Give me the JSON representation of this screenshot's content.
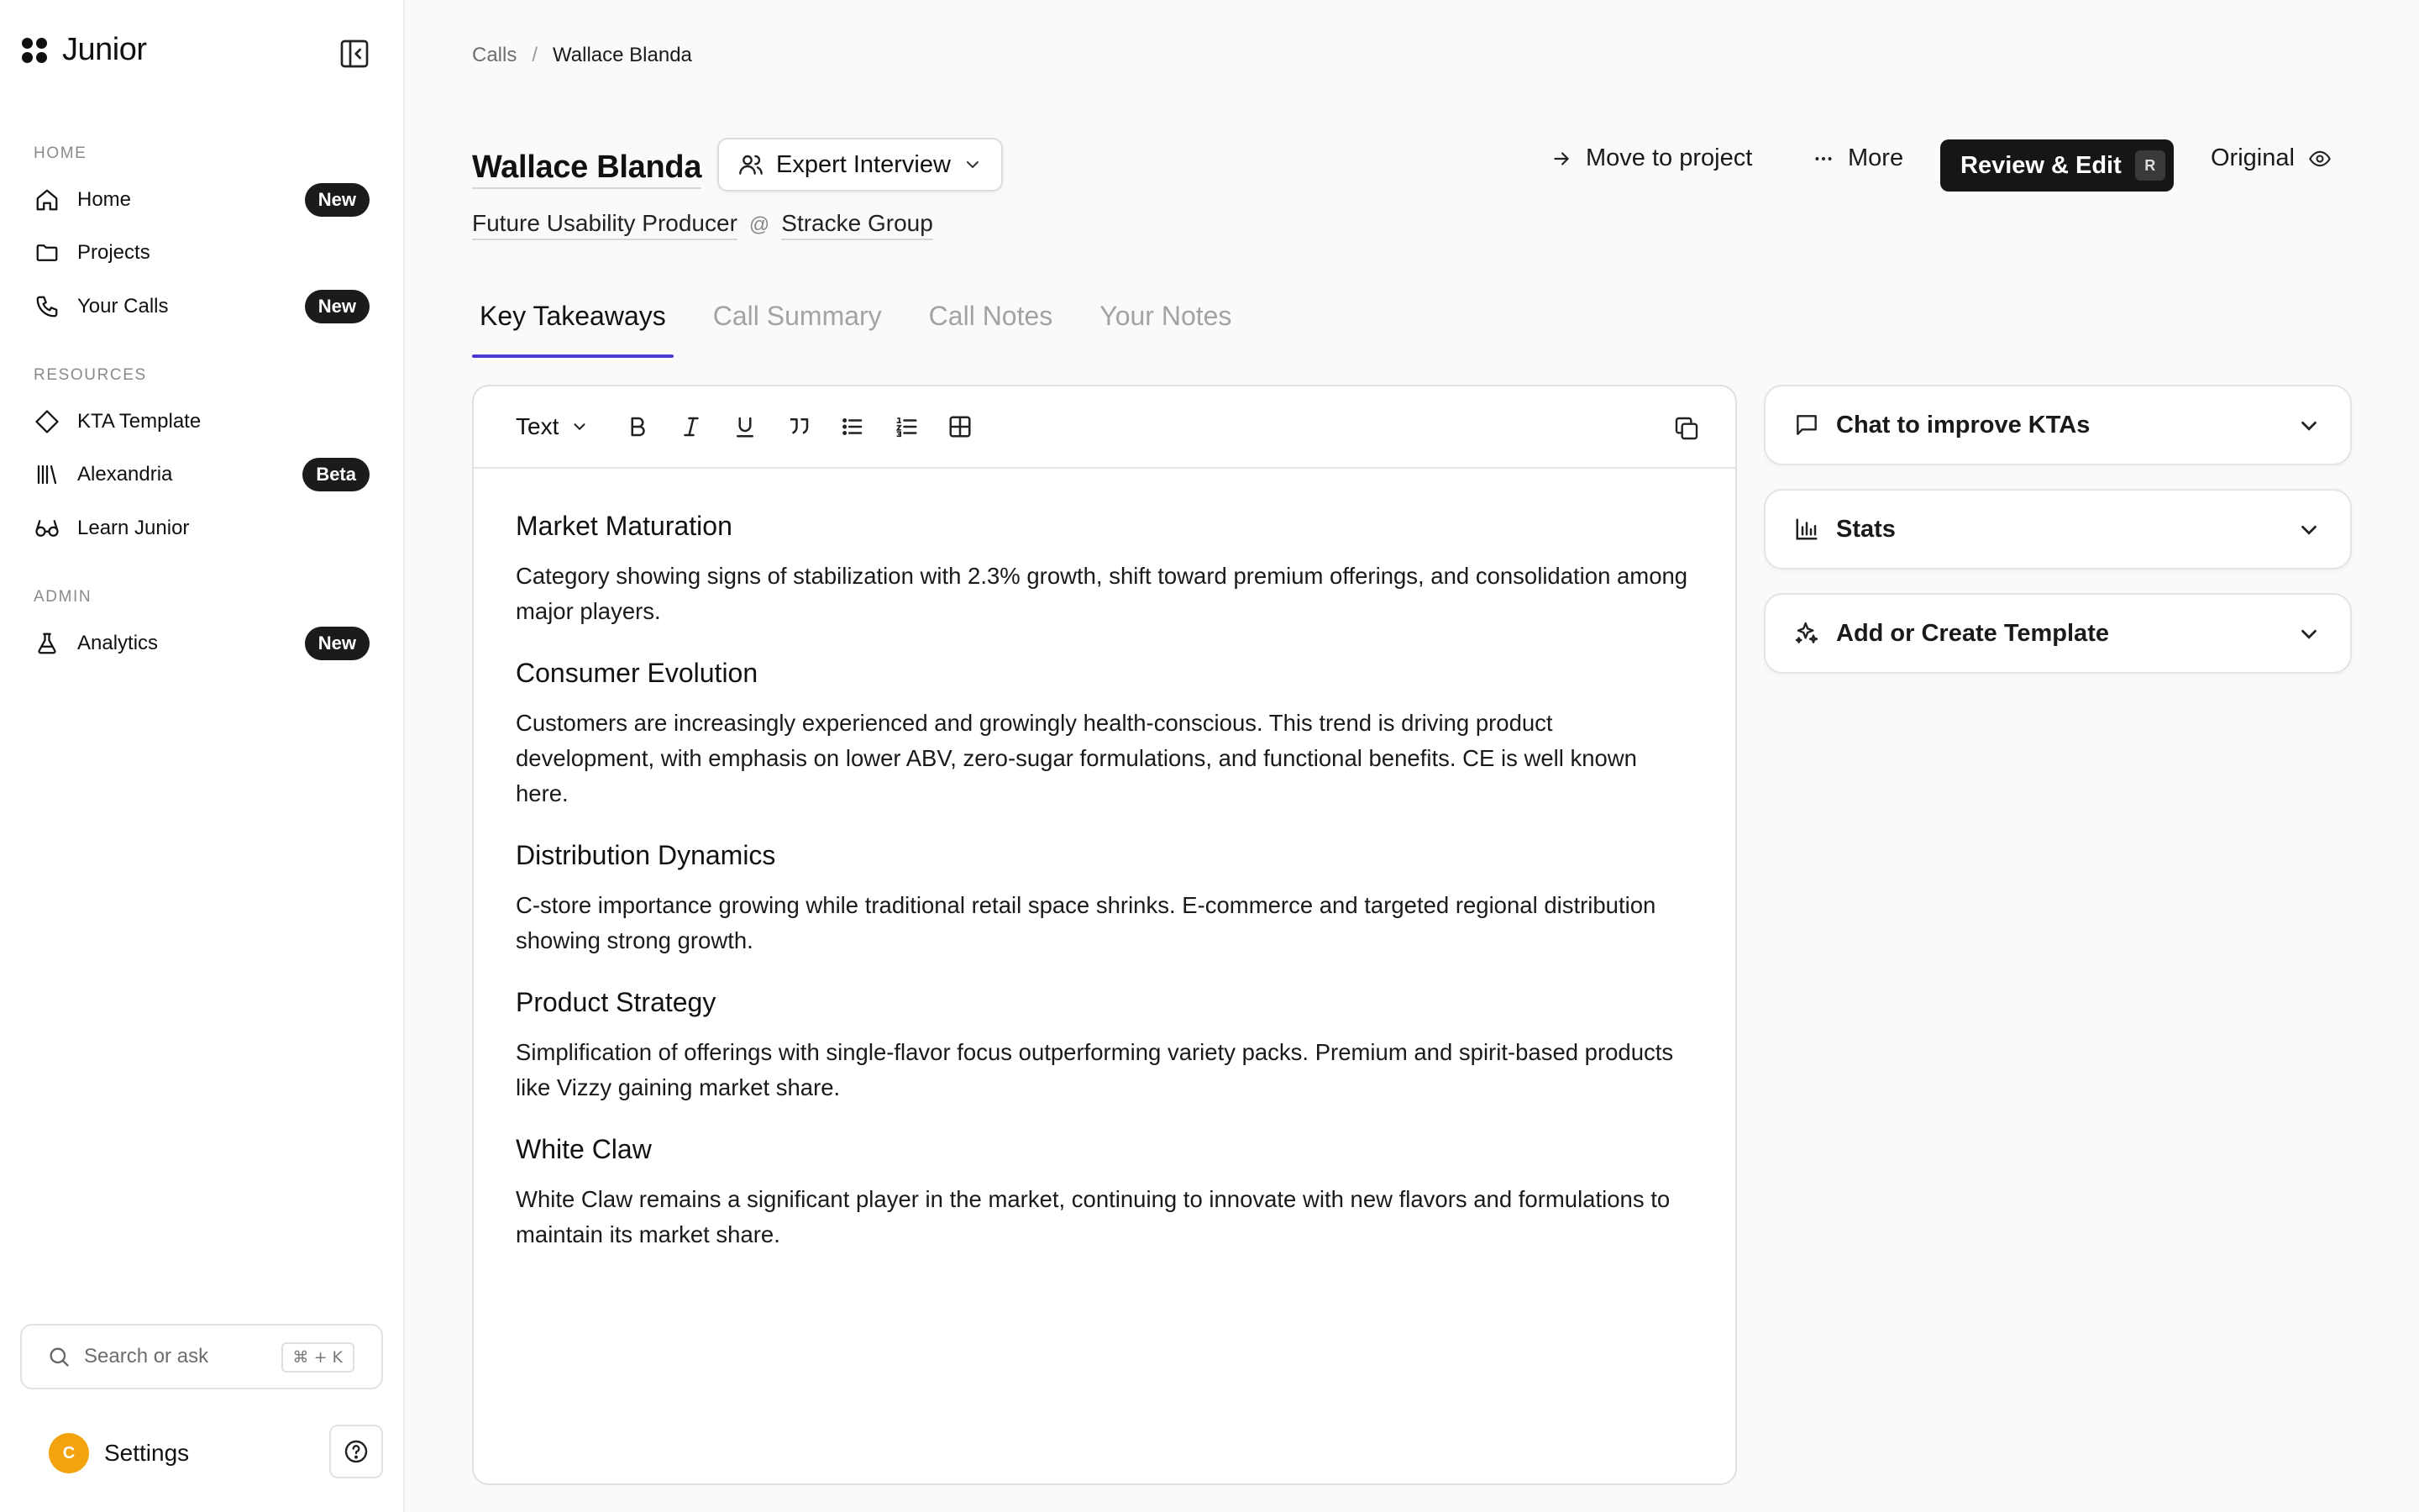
{
  "sidebar": {
    "brand": "Junior",
    "sections": {
      "home": "HOME",
      "resources": "RESOURCES",
      "admin": "ADMIN"
    },
    "items": [
      {
        "label": "Home",
        "icon": "home-icon",
        "badge": "New"
      },
      {
        "label": "Projects",
        "icon": "folder-icon",
        "badge": ""
      },
      {
        "label": "Your Calls",
        "icon": "phone-icon",
        "badge": "New"
      },
      {
        "label": "KTA Template",
        "icon": "diamond-icon",
        "badge": ""
      },
      {
        "label": "Alexandria",
        "icon": "library-icon",
        "badge": "Beta"
      },
      {
        "label": "Learn Junior",
        "icon": "glasses-icon",
        "badge": ""
      },
      {
        "label": "Analytics",
        "icon": "flask-icon",
        "badge": "New"
      }
    ],
    "search": {
      "placeholder": "Search or ask",
      "shortcut": "⌘ + K"
    },
    "settings": {
      "avatar_letter": "C",
      "label": "Settings"
    }
  },
  "breadcrumb": {
    "parent": "Calls",
    "separator": "/",
    "current": "Wallace Blanda"
  },
  "header": {
    "name": "Wallace Blanda",
    "call_type": "Expert Interview",
    "job_title": "Future Usability Producer",
    "at": "@",
    "company": "Stracke Group",
    "actions": {
      "move": "Move to project",
      "more": "More",
      "review": "Review & Edit",
      "review_shortcut": "R",
      "original": "Original"
    }
  },
  "tabs": [
    {
      "label": "Key Takeaways",
      "active": true
    },
    {
      "label": "Call Summary",
      "active": false
    },
    {
      "label": "Call Notes",
      "active": false
    },
    {
      "label": "Your Notes",
      "active": false
    }
  ],
  "editor": {
    "text_style": "Text",
    "sections": [
      {
        "heading": "Market Maturation",
        "body": "Category showing signs of stabilization with 2.3% growth, shift toward premium offerings, and consolidation among major players."
      },
      {
        "heading": "Consumer Evolution",
        "body": "Customers are increasingly experienced and growingly health-conscious. This trend is driving product development, with emphasis on lower ABV, zero-sugar formulations, and functional benefits. CE is well known here."
      },
      {
        "heading": "Distribution Dynamics",
        "body": "C-store importance growing while traditional retail space shrinks. E-commerce and targeted regional distribution showing strong growth."
      },
      {
        "heading": "Product Strategy",
        "body": "Simplification of offerings with single-flavor focus outperforming variety packs. Premium and spirit-based products like Vizzy gaining market share."
      },
      {
        "heading": "White Claw",
        "body": "White Claw remains a significant player in the market, continuing to innovate with new flavors and formulations to maintain its market share."
      }
    ]
  },
  "panels": {
    "chat": "Chat to improve KTAs",
    "stats": "Stats",
    "template": "Add or Create Template"
  },
  "colors": {
    "accent": "#4b3bd1",
    "badge_bg": "#1b1b1b",
    "avatar": "#f2a30f"
  }
}
